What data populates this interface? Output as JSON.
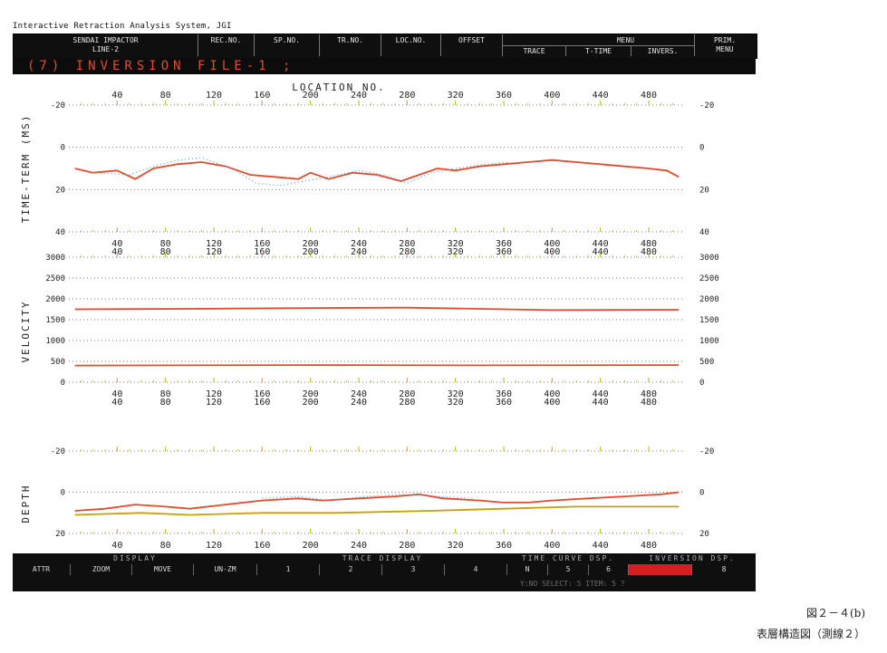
{
  "window": {
    "title": "Interactive Retraction Analysis System, JGI"
  },
  "header": {
    "project_line1": "SENDAI IMPACTOR",
    "project_line2": "LINE-2",
    "cells": [
      "REC.NO.",
      "SP.NO.",
      "TR.NO.",
      "LOC.NO.",
      "OFFSET"
    ],
    "menu_title": "MENU",
    "menu_items": [
      "TRACE",
      "T-TIME",
      "INVERS."
    ],
    "prim_line1": "PRIM.",
    "prim_line2": "MENU"
  },
  "file_line": "(7) INVERSION FILE-1 ;",
  "colors": {
    "accent_red": "#e34b2d",
    "dot_blue": "#4aa0d8",
    "tick_yellow": "#c8b000",
    "grid_gray": "#7a7a7a",
    "active_cell": "#d61e1e"
  },
  "chart_data": [
    {
      "type": "line",
      "name": "time-term",
      "title": "LOCATION NO.",
      "ylabel": "TIME-TERM (MS)",
      "x_ticks": [
        40,
        80,
        120,
        160,
        200,
        240,
        280,
        320,
        360,
        400,
        440,
        480
      ],
      "y_ticks": [
        -20,
        0,
        20,
        40
      ],
      "ylim": [
        -20,
        40
      ],
      "xlim": [
        0,
        510
      ],
      "series": [
        {
          "color": "#e34b2d",
          "values": [
            [
              5,
              10
            ],
            [
              20,
              12
            ],
            [
              40,
              11
            ],
            [
              55,
              15
            ],
            [
              70,
              10
            ],
            [
              90,
              8
            ],
            [
              110,
              7
            ],
            [
              130,
              9
            ],
            [
              150,
              13
            ],
            [
              170,
              14
            ],
            [
              190,
              15
            ],
            [
              200,
              12
            ],
            [
              215,
              15
            ],
            [
              235,
              12
            ],
            [
              255,
              13
            ],
            [
              275,
              16
            ],
            [
              290,
              13
            ],
            [
              305,
              10
            ],
            [
              320,
              11
            ],
            [
              340,
              9
            ],
            [
              360,
              8
            ],
            [
              380,
              7
            ],
            [
              400,
              6
            ],
            [
              420,
              7
            ],
            [
              440,
              8
            ],
            [
              460,
              9
            ],
            [
              480,
              10
            ],
            [
              495,
              11
            ],
            [
              505,
              14
            ]
          ]
        },
        {
          "color": "#4aa0d8",
          "values": [
            [
              20,
              12
            ],
            [
              50,
              13
            ],
            [
              70,
              9
            ],
            [
              90,
              6
            ],
            [
              110,
              5
            ],
            [
              135,
              10
            ],
            [
              155,
              17
            ],
            [
              175,
              18
            ],
            [
              195,
              16
            ],
            [
              215,
              14
            ],
            [
              240,
              11
            ],
            [
              260,
              13
            ],
            [
              280,
              17
            ],
            [
              300,
              12
            ],
            [
              320,
              10
            ],
            [
              345,
              8
            ],
            [
              365,
              7
            ]
          ]
        }
      ]
    },
    {
      "type": "line",
      "name": "velocity",
      "ylabel": "VELOCITY",
      "x_ticks": [
        40,
        80,
        120,
        160,
        200,
        240,
        280,
        320,
        360,
        400,
        440,
        480
      ],
      "y_ticks": [
        0,
        500,
        1000,
        1500,
        2000,
        2500,
        3000
      ],
      "ylim": [
        0,
        3000
      ],
      "xlim": [
        0,
        510
      ],
      "series": [
        {
          "color": "#e34b2d",
          "values": [
            [
              5,
              1750
            ],
            [
              100,
              1760
            ],
            [
              200,
              1780
            ],
            [
              280,
              1790
            ],
            [
              340,
              1760
            ],
            [
              400,
              1730
            ],
            [
              505,
              1740
            ]
          ]
        },
        {
          "color": "#e34b2d",
          "values": [
            [
              5,
              400
            ],
            [
              200,
              410
            ],
            [
              340,
              405
            ],
            [
              505,
              410
            ]
          ]
        }
      ]
    },
    {
      "type": "line",
      "name": "depth",
      "ylabel": "DEPTH",
      "x_ticks": [
        40,
        80,
        120,
        160,
        200,
        240,
        280,
        320,
        360,
        400,
        440,
        480
      ],
      "y_ticks": [
        -20,
        0,
        20
      ],
      "ylim": [
        -20,
        20
      ],
      "xlim": [
        0,
        510
      ],
      "series": [
        {
          "color": "#e34b2d",
          "values": [
            [
              5,
              9
            ],
            [
              30,
              8
            ],
            [
              55,
              6
            ],
            [
              80,
              7
            ],
            [
              100,
              8
            ],
            [
              130,
              6
            ],
            [
              160,
              4
            ],
            [
              190,
              3
            ],
            [
              210,
              4
            ],
            [
              240,
              3
            ],
            [
              270,
              2
            ],
            [
              290,
              1
            ],
            [
              310,
              3
            ],
            [
              340,
              4
            ],
            [
              360,
              5
            ],
            [
              380,
              5
            ],
            [
              400,
              4
            ],
            [
              430,
              3
            ],
            [
              460,
              2
            ],
            [
              490,
              1
            ],
            [
              505,
              0
            ]
          ]
        },
        {
          "color": "#c8a000",
          "values": [
            [
              5,
              11
            ],
            [
              60,
              10
            ],
            [
              100,
              11
            ],
            [
              160,
              10
            ],
            [
              220,
              10
            ],
            [
              300,
              9
            ],
            [
              360,
              8
            ],
            [
              420,
              7
            ],
            [
              505,
              7
            ]
          ]
        },
        {
          "color": "#4aa0d8",
          "values": [
            [
              160,
              3
            ],
            [
              190,
              2
            ],
            [
              215,
              4
            ],
            [
              245,
              2
            ],
            [
              275,
              1
            ],
            [
              305,
              2
            ],
            [
              335,
              3
            ]
          ]
        }
      ]
    }
  ],
  "bottom": {
    "display_title": "DISPLAY",
    "display_items": [
      "ATTR",
      "ZOOM",
      "MOVE",
      "UN-ZM"
    ],
    "trace_title": "TRACE DISPLAY",
    "trace_items": [
      "1",
      "2",
      "3",
      "4"
    ],
    "tcurve_title": "TIME CURVE DSP.",
    "tcurve_items": [
      "N",
      "5",
      "6"
    ],
    "inv_title": "INVERSION DSP.",
    "inv_items": [
      "",
      "8"
    ],
    "status_text": "Y:NO   SELECT: 5  ITEM: 5    ?"
  },
  "figure": {
    "caption": "図２－４(b)",
    "subcaption": "表層構造図（測線２）"
  }
}
